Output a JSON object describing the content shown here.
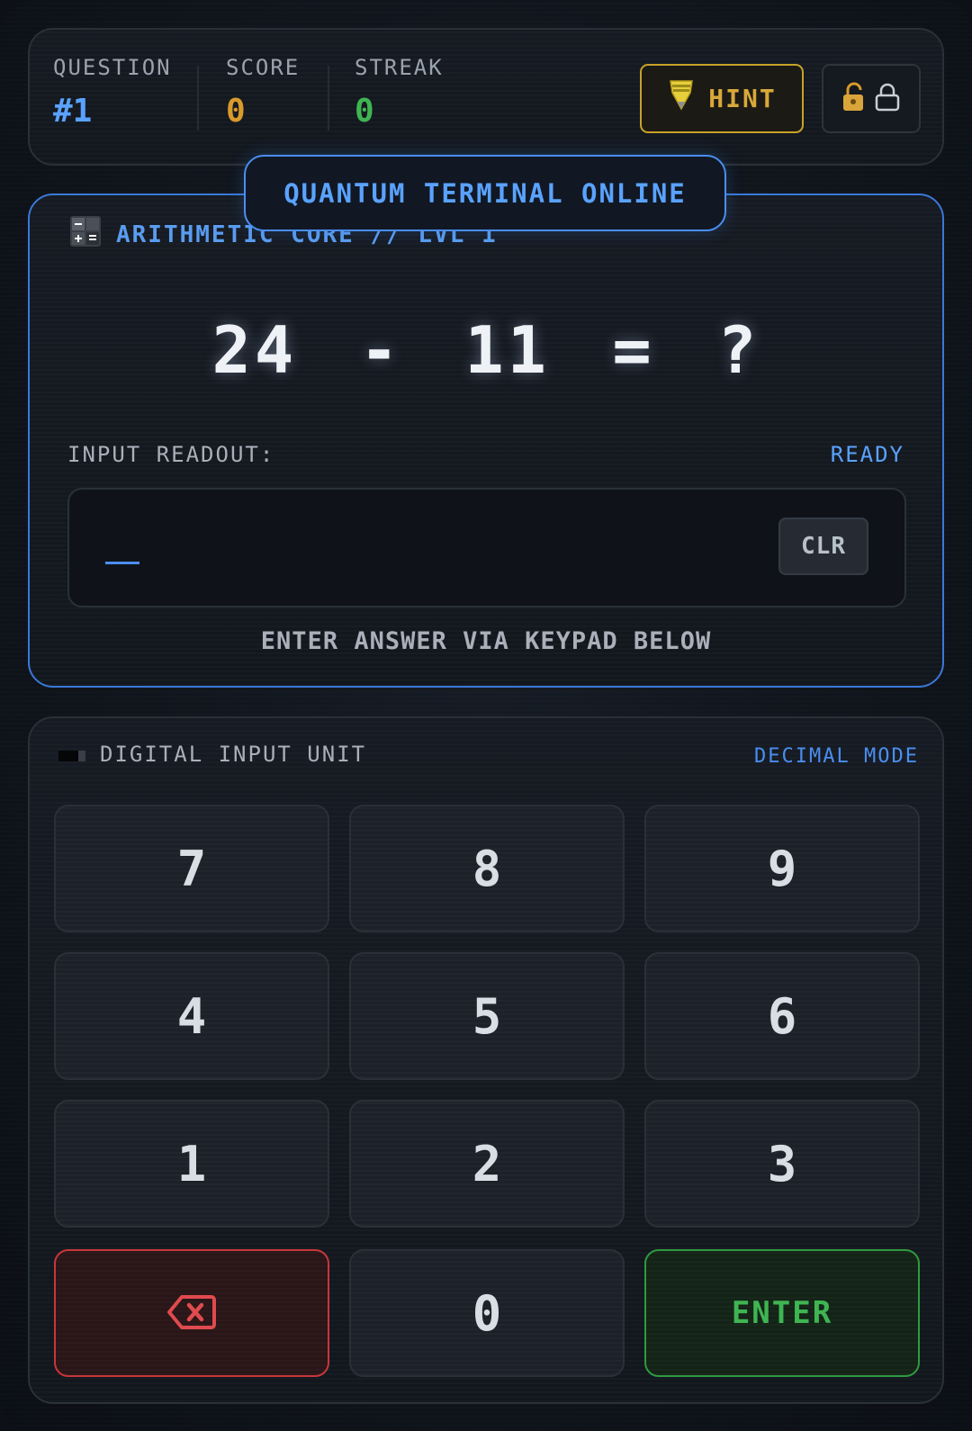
{
  "header": {
    "question": {
      "label": "QUESTION",
      "value": "#1"
    },
    "score": {
      "label": "SCORE",
      "value": "0"
    },
    "streak": {
      "label": "STREAK",
      "value": "0"
    },
    "hint_label": "HINT"
  },
  "badge": "QUANTUM TERMINAL ONLINE",
  "module": {
    "title": "ARITHMETIC CORE // LVL 1"
  },
  "problem": {
    "operand_a": "24",
    "operator": "-",
    "operand_b": "11",
    "equals": "=",
    "unknown": "?"
  },
  "readout": {
    "label": "INPUT READOUT:",
    "status": "READY",
    "value": "",
    "clear_label": "CLR"
  },
  "instruction": "ENTER ANSWER VIA KEYPAD BELOW",
  "keypad": {
    "title": "DIGITAL INPUT UNIT",
    "mode": "DECIMAL MODE",
    "keys": [
      "7",
      "8",
      "9",
      "4",
      "5",
      "6",
      "1",
      "2",
      "3"
    ],
    "zero": "0",
    "enter_label": "ENTER"
  },
  "colors": {
    "accent_blue": "#4a8ef0",
    "question_value": "#5aa2ff",
    "score_value": "#d89a2a",
    "streak_value": "#3fb552",
    "hint": "#d8a93a",
    "backspace": "#e04a4e",
    "enter": "#3fb552"
  },
  "icons": [
    "bulb-icon",
    "unlock-icon",
    "lock-icon",
    "calculator-icon",
    "keypad-indicator-icon",
    "backspace-icon"
  ]
}
